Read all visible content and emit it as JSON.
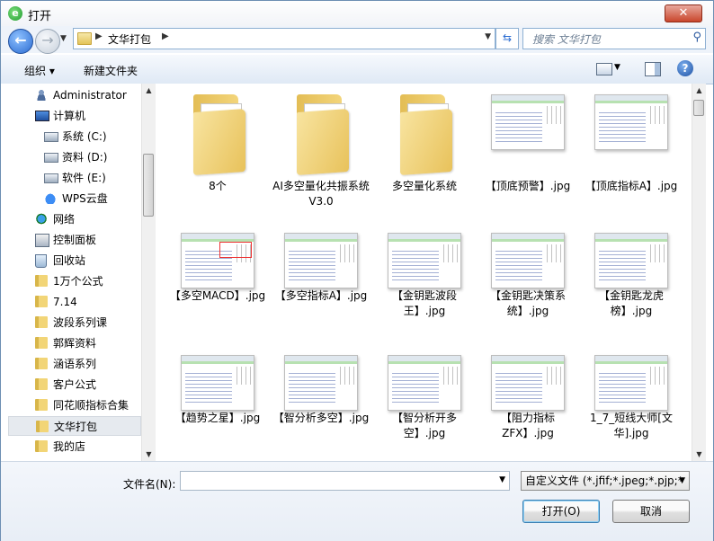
{
  "window": {
    "title": "打开",
    "close": "✕"
  },
  "address": {
    "path": "文华打包",
    "search_placeholder": "搜索 文华打包"
  },
  "toolbar": {
    "organize": "组织 ▾",
    "new_folder": "新建文件夹",
    "help": "?"
  },
  "sidebar": {
    "items": [
      {
        "label": "Administrator",
        "icon": "user-icon"
      },
      {
        "label": "计算机",
        "icon": "computer-icon"
      },
      {
        "label": "系统 (C:)",
        "icon": "drive-icon"
      },
      {
        "label": "资料 (D:)",
        "icon": "drive-icon"
      },
      {
        "label": "软件 (E:)",
        "icon": "drive-icon"
      },
      {
        "label": "WPS云盘",
        "icon": "cloud-icon"
      },
      {
        "label": "网络",
        "icon": "network-icon"
      },
      {
        "label": "控制面板",
        "icon": "control-panel-icon"
      },
      {
        "label": "回收站",
        "icon": "recycle-bin-icon"
      },
      {
        "label": "1万个公式",
        "icon": "folder-icon"
      },
      {
        "label": "7.14",
        "icon": "folder-icon"
      },
      {
        "label": "波段系列课",
        "icon": "folder-icon"
      },
      {
        "label": "郭辉资料",
        "icon": "folder-icon"
      },
      {
        "label": "涵语系列",
        "icon": "folder-icon"
      },
      {
        "label": "客户公式",
        "icon": "folder-icon"
      },
      {
        "label": "同花顺指标合集",
        "icon": "folder-icon"
      },
      {
        "label": "文华打包",
        "icon": "folder-icon",
        "selected": true
      },
      {
        "label": "我的店",
        "icon": "folder-icon"
      }
    ]
  },
  "files": [
    {
      "label": "8个",
      "kind": "folder"
    },
    {
      "label": "AI多空量化共振系统V3.0",
      "kind": "folder"
    },
    {
      "label": "多空量化系统",
      "kind": "folder"
    },
    {
      "label": "【顶底预警】.jpg",
      "kind": "image"
    },
    {
      "label": "【顶底指标A】.jpg",
      "kind": "image"
    },
    {
      "label": "【多空MACD】.jpg",
      "kind": "image",
      "red": true
    },
    {
      "label": "【多空指标A】.jpg",
      "kind": "image"
    },
    {
      "label": "【金钥匙波段王】.jpg",
      "kind": "image"
    },
    {
      "label": "【金钥匙决策系统】.jpg",
      "kind": "image"
    },
    {
      "label": "【金钥匙龙虎榜】.jpg",
      "kind": "image"
    },
    {
      "label": "【趋势之星】.jpg",
      "kind": "image"
    },
    {
      "label": "【智分析多空】.jpg",
      "kind": "image"
    },
    {
      "label": "【智分析开多空】.jpg",
      "kind": "image"
    },
    {
      "label": "【阻力指标ZFX】.jpg",
      "kind": "image"
    },
    {
      "label": "1_7_短线大师[文华].jpg",
      "kind": "image"
    }
  ],
  "bottom": {
    "filename_label": "文件名(N):",
    "filename_value": "",
    "filter": "自定义文件 (*.jfif;*.jpeg;*.pjp;*",
    "open": "打开(O)",
    "cancel": "取消"
  }
}
